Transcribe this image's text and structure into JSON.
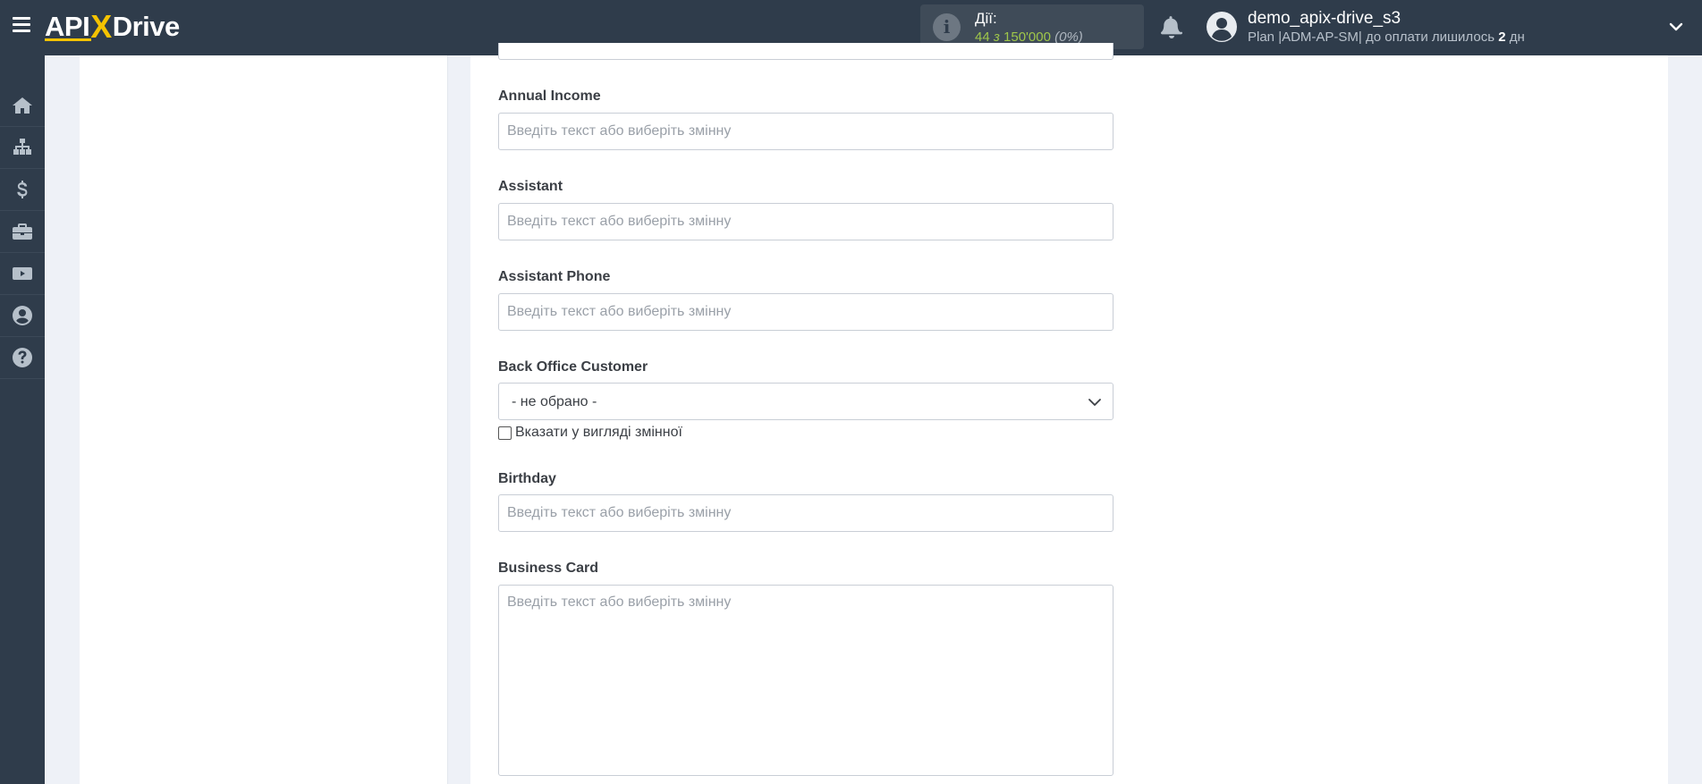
{
  "header": {
    "logo": {
      "left": "API",
      "x": "X",
      "right": "Drive"
    },
    "actions": {
      "label": "Дії:",
      "used": "44",
      "of": "з",
      "total": "150'000",
      "percent": "(0%)"
    },
    "user": {
      "name": "demo_apix-drive_s3",
      "plan_prefix": "Plan |ADM-AP-SM| до оплати лишилось ",
      "days": "2",
      "plan_suffix": " дн"
    }
  },
  "sidebar": {
    "items": [
      {
        "icon": "home-icon"
      },
      {
        "icon": "sitemap-icon"
      },
      {
        "icon": "dollar-icon"
      },
      {
        "icon": "briefcase-icon"
      },
      {
        "icon": "youtube-icon"
      },
      {
        "icon": "user-circle-icon"
      },
      {
        "icon": "question-circle-icon"
      }
    ]
  },
  "form": {
    "placeholder": "Введіть текст або виберіть змінну",
    "fields": {
      "annual_income": {
        "label": "Annual Income"
      },
      "assistant": {
        "label": "Assistant"
      },
      "assistant_phone": {
        "label": "Assistant Phone"
      },
      "back_office_customer": {
        "label": "Back Office Customer",
        "value": "- не обрано -",
        "checkbox_label": "Вказати у вигляді змінної"
      },
      "birthday": {
        "label": "Birthday"
      },
      "business_card": {
        "label": "Business Card"
      }
    }
  },
  "colors": {
    "topbar": "#2f3c4b",
    "accent_yellow": "#f5c300",
    "actions_green": "#9fc64a",
    "page_background": "#eef1f7"
  }
}
